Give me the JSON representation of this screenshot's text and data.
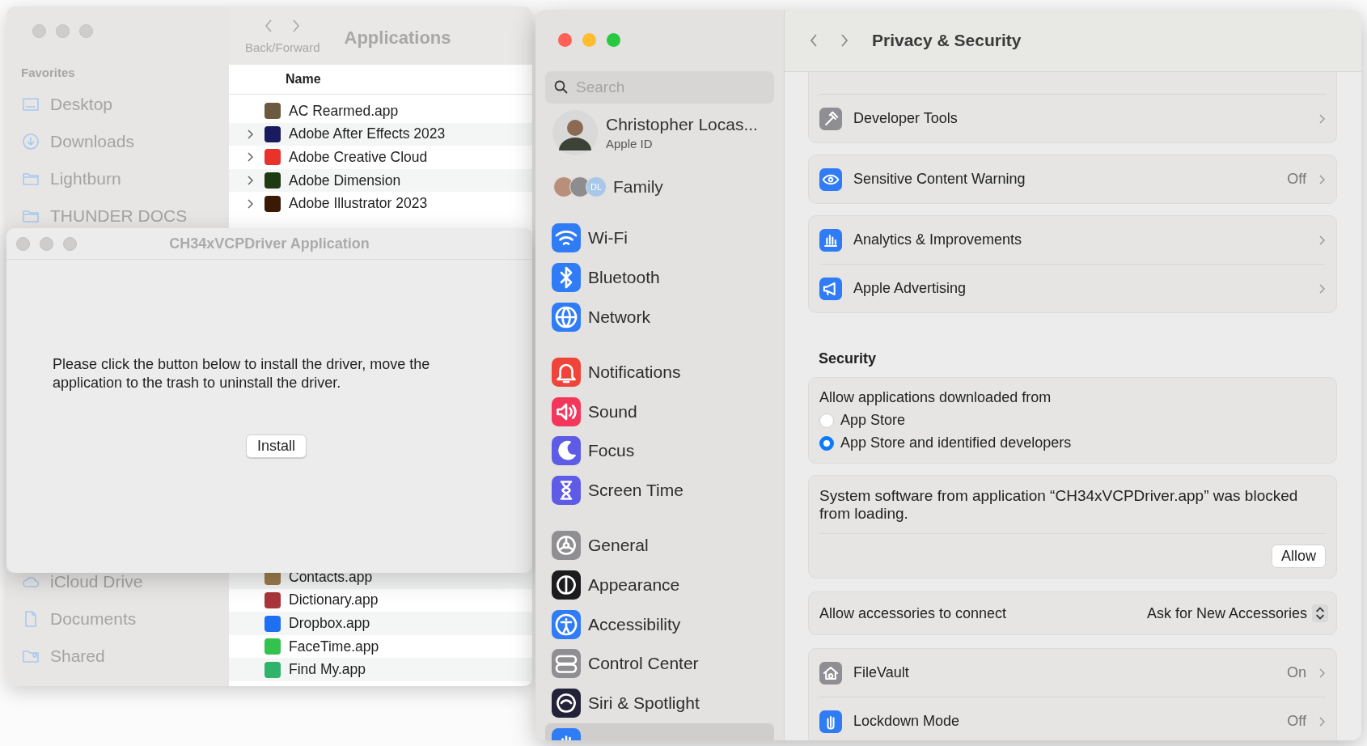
{
  "finder": {
    "back_forward_label": "Back/Forward",
    "title": "Applications",
    "sidebar": {
      "heading": "Favorites",
      "items": [
        "Desktop",
        "Downloads",
        "Lightburn",
        "THUNDER DOCS"
      ],
      "bottom_items": [
        "iCloud Drive",
        "Documents",
        "Shared"
      ]
    },
    "column": "Name",
    "rows": [
      {
        "name": "AC Rearmed.app",
        "expandable": false
      },
      {
        "name": "Adobe After Effects 2023",
        "expandable": true
      },
      {
        "name": "Adobe Creative Cloud",
        "expandable": true
      },
      {
        "name": "Adobe Dimension",
        "expandable": true
      },
      {
        "name": "Adobe Illustrator 2023",
        "expandable": true
      }
    ],
    "rows_lower": [
      {
        "name": "Contacts.app",
        "expandable": false
      },
      {
        "name": "Dictionary.app",
        "expandable": false
      },
      {
        "name": "Dropbox.app",
        "expandable": false
      },
      {
        "name": "FaceTime.app",
        "expandable": false
      },
      {
        "name": "Find My.app",
        "expandable": false
      }
    ]
  },
  "dialog": {
    "title": "CH34xVCPDriver Application",
    "message": "Please click the button below to install the driver, move the application to the trash to uninstall the driver.",
    "button": "Install"
  },
  "settings": {
    "sidebar": {
      "search": {
        "placeholder": "Search"
      },
      "account": {
        "name": "Christopher Locas...",
        "subtitle": "Apple ID"
      },
      "family": {
        "label": "Family",
        "badge": "DL"
      },
      "groups": [
        [
          {
            "label": "Wi-Fi",
            "selected": false
          },
          {
            "label": "Bluetooth",
            "selected": false
          },
          {
            "label": "Network",
            "selected": false
          }
        ],
        [
          {
            "label": "Notifications",
            "selected": false
          },
          {
            "label": "Sound",
            "selected": false
          },
          {
            "label": "Focus",
            "selected": false
          },
          {
            "label": "Screen Time",
            "selected": false
          }
        ],
        [
          {
            "label": "General",
            "selected": false
          },
          {
            "label": "Appearance",
            "selected": false
          },
          {
            "label": "Accessibility",
            "selected": false
          },
          {
            "label": "Control Center",
            "selected": false
          },
          {
            "label": "Siri & Spotlight",
            "selected": false
          },
          {
            "selected": true
          }
        ]
      ]
    },
    "title": "Privacy & Security",
    "sections": [
      {
        "kind": "list",
        "rows": [
          {
            "label": "Developer Tools"
          }
        ]
      },
      {
        "kind": "list",
        "rows": [
          {
            "label": "Sensitive Content Warning",
            "value": "Off"
          }
        ]
      },
      {
        "kind": "list",
        "rows": [
          {
            "label": "Analytics & Improvements"
          },
          {
            "label": "Apple Advertising"
          }
        ]
      },
      {
        "kind": "heading",
        "label": "Security"
      },
      {
        "kind": "radios",
        "label": "Allow applications downloaded from",
        "options": [
          {
            "label": "App Store",
            "selected": false
          },
          {
            "label": "App Store and identified developers",
            "selected": true
          }
        ]
      },
      {
        "kind": "message",
        "text": "System software from application “CH34xVCPDriver.app” was blocked from loading.",
        "button": "Allow"
      },
      {
        "kind": "popup",
        "label": "Allow accessories to connect",
        "value": "Ask for New Accessories"
      },
      {
        "kind": "list",
        "rows": [
          {
            "label": "FileVault",
            "value": "On"
          },
          {
            "label": "Lockdown Mode",
            "value": "Off"
          }
        ]
      }
    ]
  }
}
